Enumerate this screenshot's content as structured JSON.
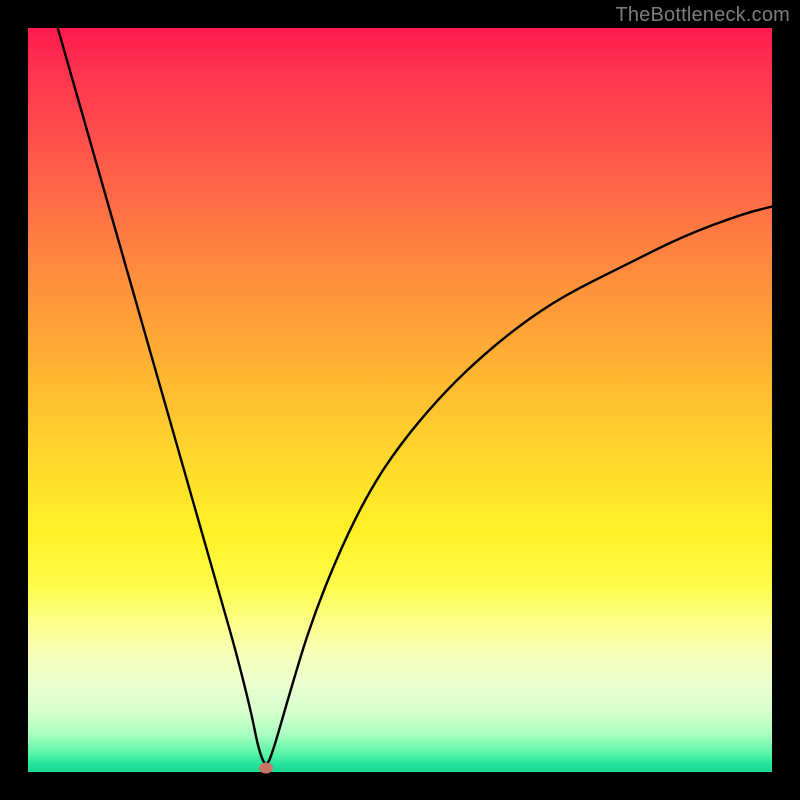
{
  "watermark": "TheBottleneck.com",
  "chart_data": {
    "type": "line",
    "title": "",
    "xlabel": "",
    "ylabel": "",
    "xlim": [
      0,
      100
    ],
    "ylim": [
      0,
      100
    ],
    "grid": false,
    "series": [
      {
        "name": "bottleneck-curve",
        "x": [
          4,
          6,
          8,
          10,
          12,
          14,
          16,
          18,
          20,
          22,
          24,
          26,
          28,
          30,
          31,
          32,
          33,
          35,
          38,
          42,
          46,
          50,
          55,
          60,
          66,
          72,
          80,
          88,
          96,
          100
        ],
        "values": [
          100,
          93,
          86,
          79,
          72,
          65,
          58,
          51,
          44,
          37,
          30,
          23,
          16,
          8,
          3,
          0.5,
          3,
          10,
          20,
          30,
          38,
          44,
          50,
          55,
          60,
          64,
          68,
          72,
          75,
          76
        ]
      }
    ],
    "annotations": [
      {
        "name": "optimal-marker",
        "x": 32,
        "y": 0.5,
        "color": "#c77765"
      }
    ],
    "background_gradient": {
      "direction": "vertical",
      "stops": [
        {
          "pos": 0,
          "color": "#ff1a4d"
        },
        {
          "pos": 50,
          "color": "#ffc22e"
        },
        {
          "pos": 75,
          "color": "#fffb4a"
        },
        {
          "pos": 95,
          "color": "#a8ffc0"
        },
        {
          "pos": 100,
          "color": "#16d994"
        }
      ]
    }
  }
}
